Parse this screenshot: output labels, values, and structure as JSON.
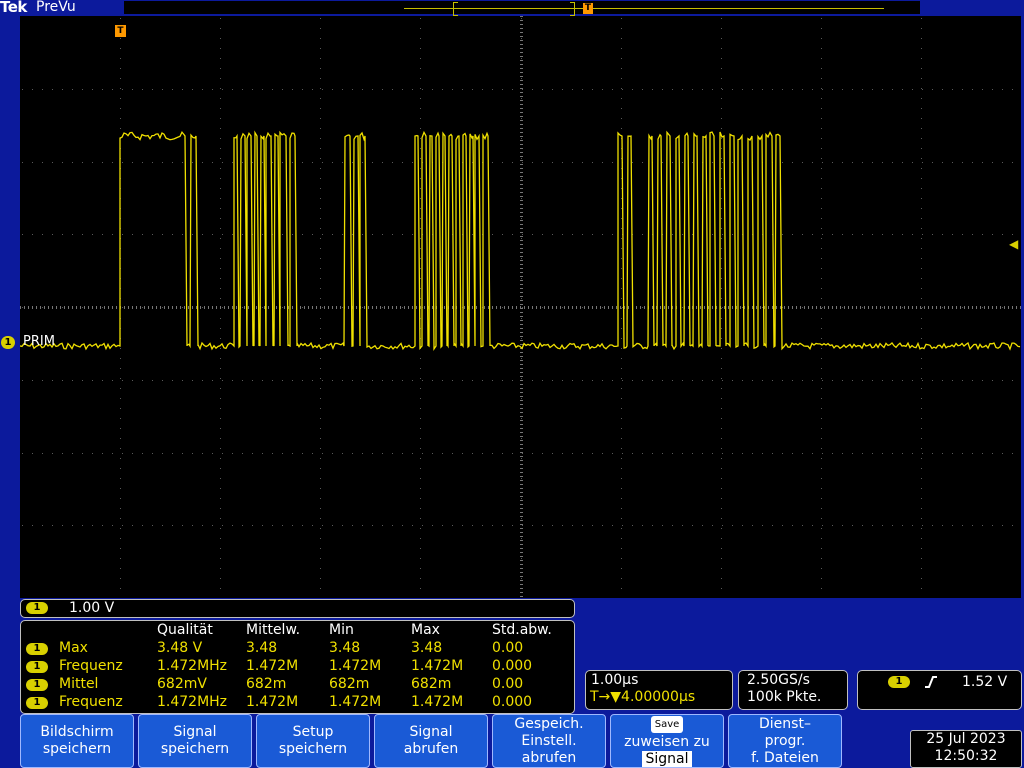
{
  "brand": "Tek",
  "mode": "PreVu",
  "channel": {
    "number": "1",
    "label": "PRIM",
    "scale": "1.00 V"
  },
  "trigger_marker": "T",
  "measurements": {
    "headers": [
      "Qualität",
      "Mittelw.",
      "Min",
      "Max",
      "Std.abw."
    ],
    "rows": [
      {
        "ch": "1",
        "name": "Max",
        "q": "3.48 V",
        "mean": "3.48",
        "min": "3.48",
        "max": "3.48",
        "std": "0.00"
      },
      {
        "ch": "1",
        "name": "Frequenz",
        "q": "1.472MHz",
        "mean": "1.472M",
        "min": "1.472M",
        "max": "1.472M",
        "std": "0.000"
      },
      {
        "ch": "1",
        "name": "Mittel",
        "q": "682mV",
        "mean": "682m",
        "min": "682m",
        "max": "682m",
        "std": "0.00"
      },
      {
        "ch": "1",
        "name": "Frequenz",
        "q": "1.472MHz",
        "mean": "1.472M",
        "min": "1.472M",
        "max": "1.472M",
        "std": "0.000"
      }
    ]
  },
  "timebase": {
    "scale": "1.00µs",
    "position": "T→▼4.00000µs"
  },
  "acquisition": {
    "rate": "2.50GS/s",
    "record": "100k Pkte."
  },
  "trigger": {
    "channel": "1",
    "slope_icon": "rising-edge-icon",
    "level": "1.52 V"
  },
  "softkeys": [
    {
      "line1": "Bildschirm",
      "line2": "speichern"
    },
    {
      "line1": "Signal",
      "line2": "speichern"
    },
    {
      "line1": "Setup",
      "line2": "speichern"
    },
    {
      "line1": "Signal",
      "line2": "abrufen"
    },
    {
      "line1": "Gespeich.",
      "line2": "Einstell.",
      "line3": "abrufen"
    },
    {
      "badge": "Save",
      "line1": "zuweisen zu",
      "line2": "Signal"
    },
    {
      "line1": "Dienst–",
      "line2": "progr.",
      "line3": "f. Dateien"
    }
  ],
  "date": "25 Jul  2023",
  "time": "12:50:32",
  "colors": {
    "trace": "#f0e000",
    "frame": "#0c1a9c",
    "button": "#1a5ad6"
  }
}
